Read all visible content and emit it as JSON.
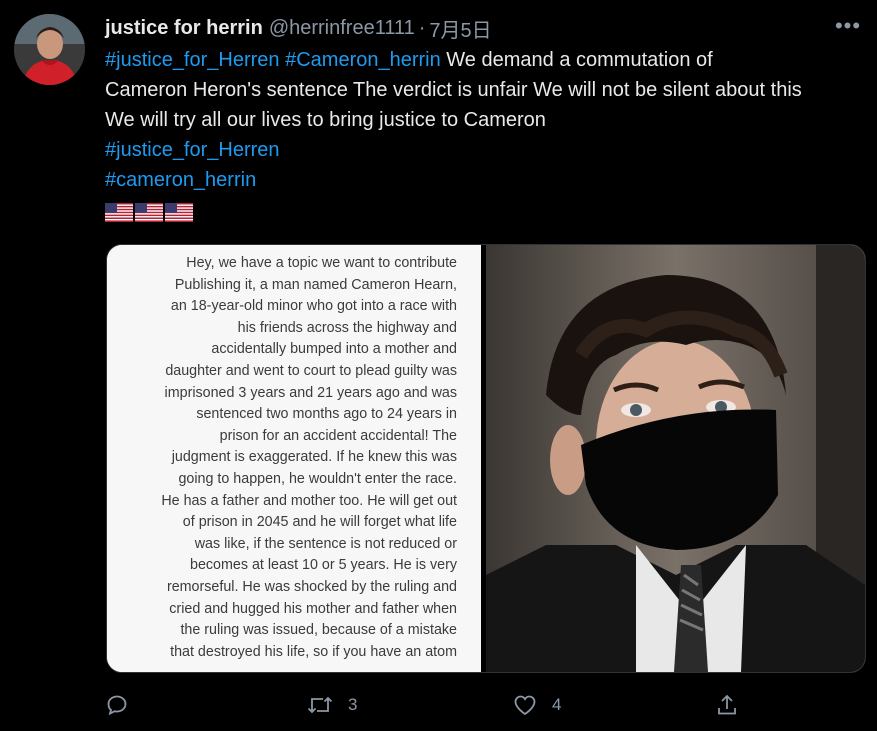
{
  "tweet": {
    "display_name": "justice for herrin",
    "handle": "@herrinfree1111",
    "separator": "·",
    "date": "7月5日",
    "more_label": "•••",
    "text_lines": [
      {
        "tag1": "#justice_for_Herren",
        "tag2": "#Cameron_herrin",
        "rest": " We demand a commutation of"
      },
      {
        "text": "Cameron Heron's sentence The verdict is unfair We will not be silent about this"
      },
      {
        "text": "We will try all our lives to bring justice to Cameron"
      },
      {
        "tag": "#justice_for_Herren"
      },
      {
        "tag": "#cameron_herrin"
      }
    ],
    "flags": [
      "us-flag",
      "us-flag",
      "us-flag"
    ]
  },
  "media": {
    "text_image_lines": [
      "Hey, we have a topic we want to contribute",
      "Publishing it, a man named Cameron Hearn,",
      "an 18-year-old minor who got into a race with",
      "his friends across the highway and",
      "accidentally bumped into a mother and",
      "daughter and went to court to plead guilty was",
      "imprisoned 3 years and 21 years ago and was",
      "sentenced two months ago to 24 years in",
      "prison for an accident accidental! The",
      "judgment is exaggerated. If he knew this was",
      "going to happen, he wouldn't enter the race.",
      "He has a father and mother too. He will get out",
      "of prison in 2045 and he will forget what life",
      "was like, if the sentence is not reduced or",
      "becomes at least 10 or 5 years. He is very",
      "remorseful. He was shocked by the ruling and",
      "cried and hugged his mother and father when",
      "the ruling was issued, because of a mistake",
      "that destroyed his life, so if you have an atom"
    ],
    "photo": "young man with dark curly hair wearing a black face mask and suit"
  },
  "actions": {
    "reply": {
      "icon": "reply-icon",
      "count": ""
    },
    "retweet": {
      "icon": "retweet-icon",
      "count": "3"
    },
    "like": {
      "icon": "heart-icon",
      "count": "4"
    },
    "share": {
      "icon": "share-icon",
      "count": ""
    }
  },
  "colors": {
    "background": "#000000",
    "text": "#e7e9ea",
    "muted": "#8b98a5",
    "link": "#1d9bf0"
  }
}
